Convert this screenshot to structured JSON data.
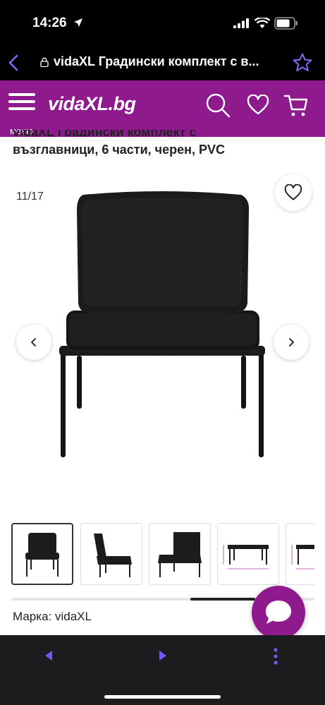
{
  "status_bar": {
    "time": "14:26"
  },
  "browser": {
    "url_title": "vidaXL Градински комплект с в..."
  },
  "header": {
    "logo_text": "vidaXL.bg",
    "menu_label": "меню"
  },
  "product": {
    "title_partial": "vidaXL Градински комплект с",
    "title_line2": "възглавници, 6 части, черен, PVC",
    "image_counter": "11/17",
    "brand_line": "Марка: vidaXL"
  },
  "colors": {
    "brand": "#8f1a8d",
    "browser_accent": "#6b5cf6"
  },
  "icons": {
    "back": "chevron-left-icon",
    "lock": "lock-icon",
    "bookmark": "star-icon",
    "menu": "hamburger-icon",
    "search": "search-icon",
    "wishlist": "heart-icon",
    "cart": "cart-icon",
    "chat": "chat-bubble-icon"
  }
}
